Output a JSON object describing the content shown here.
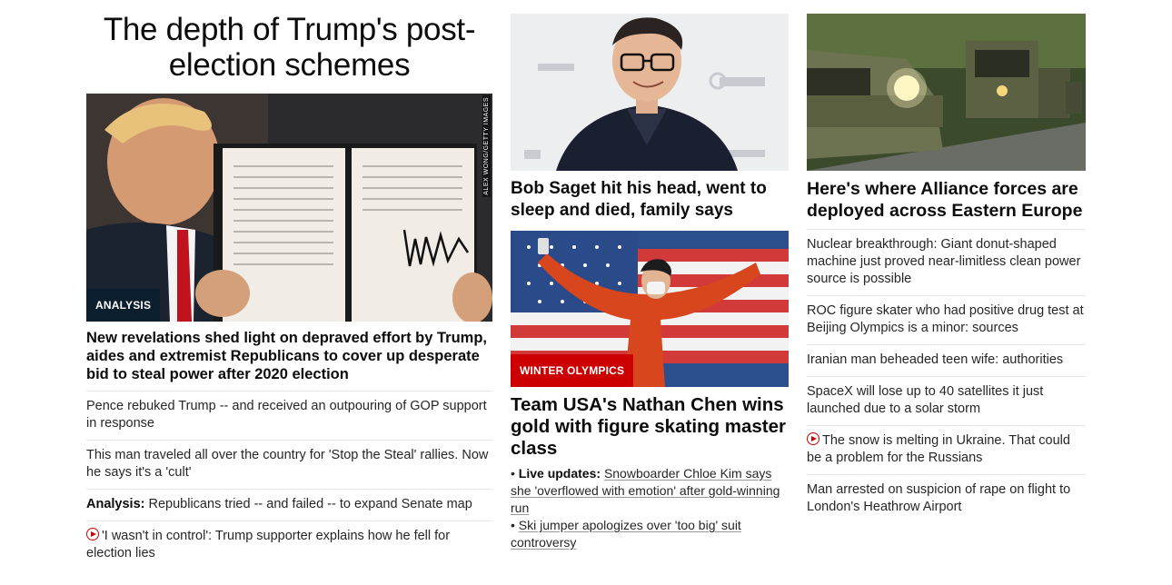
{
  "col1": {
    "banner_title": "The depth of Trump's post-election schemes",
    "hero_badge": "ANALYSIS",
    "hero_credit": "ALEX WONG/GETTY IMAGES",
    "headline": "New revelations shed light on depraved effort by Trump, aides and extremist Republicans to cover up desperate bid to steal power after 2020 election",
    "items": [
      {
        "text": "Pence rebuked Trump -- and received an outpouring of GOP support in response"
      },
      {
        "text": "This man traveled all over the country for 'Stop the Steal' rallies. Now he says it's a 'cult'"
      },
      {
        "prefix": "Analysis:",
        "text": "Republicans tried -- and failed -- to expand Senate map"
      },
      {
        "icon": "play-icon",
        "text": "'I wasn't in control': Trump supporter explains how he fell for election lies"
      }
    ]
  },
  "col2": {
    "story1_headline": "Bob Saget hit his head, went to sleep and died, family says",
    "story2_badge": "WINTER OLYMPICS",
    "story2_headline": "Team USA's Nathan Chen wins gold with figure skating master class",
    "update1_prefix": "Live updates:",
    "update1_text": "Snowboarder Chloe Kim says she 'overflowed with emotion' after gold-winning run",
    "update2_text": "Ski jumper apologizes over 'too big' suit controversy",
    "bullet": "•"
  },
  "col3": {
    "headline": "Here's where Alliance forces are deployed across Eastern Europe",
    "items": [
      {
        "text": "Nuclear breakthrough: Giant donut-shaped machine just proved near-limitless clean power source is possible"
      },
      {
        "text": "ROC figure skater who had positive drug test at Beijing Olympics is a minor: sources"
      },
      {
        "text": "Iranian man beheaded teen wife: authorities"
      },
      {
        "text": "SpaceX will lose up to 40 satellites it just launched due to a solar storm"
      },
      {
        "icon": "play-icon",
        "text": "The snow is melting in Ukraine. That could be a problem for the Russians"
      },
      {
        "text": "Man arrested on suspicion of rape on flight to London's Heathrow Airport"
      }
    ]
  },
  "colors": {
    "text": "#0c0c0c",
    "secondary_text": "#262626",
    "accent_red": "#cc0000",
    "analysis_badge": "#0b1f2e",
    "divider": "#e6e6e6"
  }
}
